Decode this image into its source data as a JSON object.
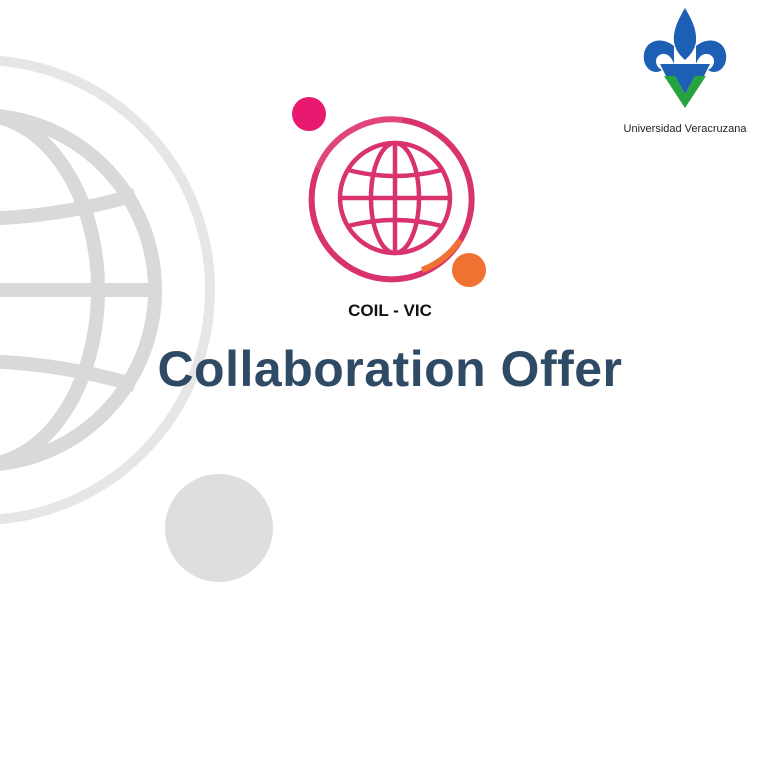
{
  "brand": {
    "university_name": "Universidad Veracruzana",
    "program_label": "COIL - VIC"
  },
  "main": {
    "title": "Collaboration Offer"
  },
  "colors": {
    "title": "#2e4a65",
    "coil_magenta": "#d8336f",
    "coil_pink_dot": "#e8196f",
    "coil_orange": "#f07233",
    "uv_blue": "#1d5fb4",
    "uv_green": "#27a33d",
    "background_gray": "#d8d8d8"
  },
  "icons": {
    "background": "globe-outline-icon",
    "program": "globe-icon",
    "university": "fleur-de-lis-icon"
  }
}
